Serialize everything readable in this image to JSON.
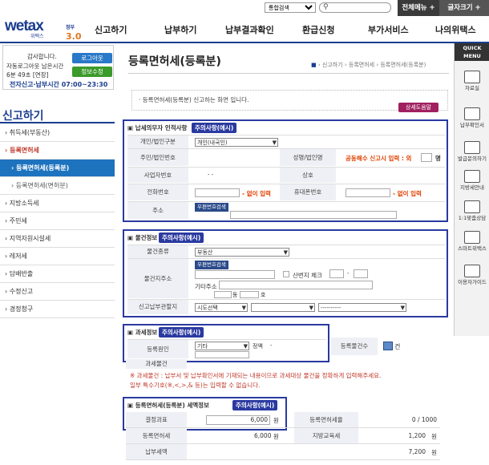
{
  "top": {
    "search_select": "통합검색",
    "full_menu": "전체메뉴",
    "font_size": "글자크기"
  },
  "logo": {
    "main": "wetax",
    "sub": "위택스",
    "gov": "정부",
    "ver": "3.0"
  },
  "gnb": [
    "신고하기",
    "납부하기",
    "납부결과확인",
    "환급신청",
    "부가서비스",
    "나의위택스"
  ],
  "login": {
    "greet": "감사합니다.",
    "auto_logout": "자동로그아웃 남은시간",
    "time_left": "6분 49초 [연장]",
    "logout": "로그아웃",
    "info_edit": "정보수정",
    "hours": "전자신고·납부시간 07:00~23:30"
  },
  "lnb": {
    "title": "신고하기",
    "items": [
      {
        "label": "› 취득세(부동산)",
        "type": "normal"
      },
      {
        "label": "› 등록면허세",
        "type": "red"
      },
      {
        "label": "› 등록면허세(등록분)",
        "type": "active"
      },
      {
        "label": "› 등록면허세(면허분)",
        "type": "sub"
      },
      {
        "label": "› 지방소득세",
        "type": "normal"
      },
      {
        "label": "› 주민세",
        "type": "normal"
      },
      {
        "label": "› 지역자원시설세",
        "type": "normal"
      },
      {
        "label": "› 레저세",
        "type": "normal"
      },
      {
        "label": "› 담배반출",
        "type": "normal"
      },
      {
        "label": "› 수정신고",
        "type": "normal"
      },
      {
        "label": "› 경정청구",
        "type": "normal"
      }
    ]
  },
  "page": {
    "title": "등록면허세(등록분)",
    "breadcrumb": "› 신고하기 › 등록면허세 › 등록면허세(등록분)",
    "intro": "· 등록면허세(등록분) 신고하는 화면 입니다.",
    "help": "상세도움말"
  },
  "sec1": {
    "head": "납세의무자 인적사항",
    "notice": "주의사항(예시)",
    "type_label": "개인/법인구분",
    "type_value": "개인(내국인)",
    "rrn_label": "주민/법인번호",
    "name_label": "성명/법인명",
    "co_owner": "공동해수 신고시 입력 : 외",
    "co_unit": "명",
    "biz_label": "사업자번호",
    "biz_dash": "-   -",
    "company_label": "상호",
    "phone_label": "전화번호",
    "phone_none": "- 없이 입력",
    "mobile_label": "휴대폰번호",
    "mobile_none": "- 없이 입력",
    "addr_label": "주소",
    "zip_btn": "우편번호검색"
  },
  "sec2": {
    "head": "물건정보",
    "notice": "주의사항(예시)",
    "kind_label": "물건종류",
    "kind_value": "부동산",
    "addr_label": "물건지주소",
    "zip_btn": "우편번호검색",
    "mountain": "산번지 체크",
    "dash": "-",
    "etc_addr": "기타주소",
    "dong": "동",
    "ho": "호",
    "office_label": "신고납부관할지",
    "office_value": "시도선택",
    "office_value3": "----------"
  },
  "sec3": {
    "head": "과세정보",
    "notice": "주의사항(예시)",
    "cause_label": "등록원인",
    "cause_value": "기타",
    "normal": "정액",
    "dash": "-",
    "count_label": "등록물건수",
    "count_unit": "건",
    "tax_item": "과세물건"
  },
  "warn": [
    "※ 과세물건 : 납부서 및 납부확인서에 기재되는 내용이므로 과세대상 물건을 정확하게 입력해주세요.",
    "일부 특수기호(※,<,>,& 등)는 입력할 수 없습니다."
  ],
  "sec4": {
    "head": "등록면허세(등록분) 세액정보",
    "notice": "주의사항(예시)",
    "base_label": "결정과표",
    "base_value": "6,000",
    "won": "원",
    "rate_label": "등록면허세율",
    "rate_value": "0 / 1000",
    "tax_label": "등록면허세",
    "tax_value": "6,000",
    "edu_label": "지방교육세",
    "edu_value": "1,200",
    "total_label": "납부세액",
    "total_value": "7,200"
  },
  "quick": {
    "head": "QUICK MENU",
    "items": [
      "자료실",
      "납부확인서",
      "발급문의하기",
      "지방세안내",
      "1:1맞춤상담",
      "스마트위택스",
      "이용자가이드"
    ]
  }
}
